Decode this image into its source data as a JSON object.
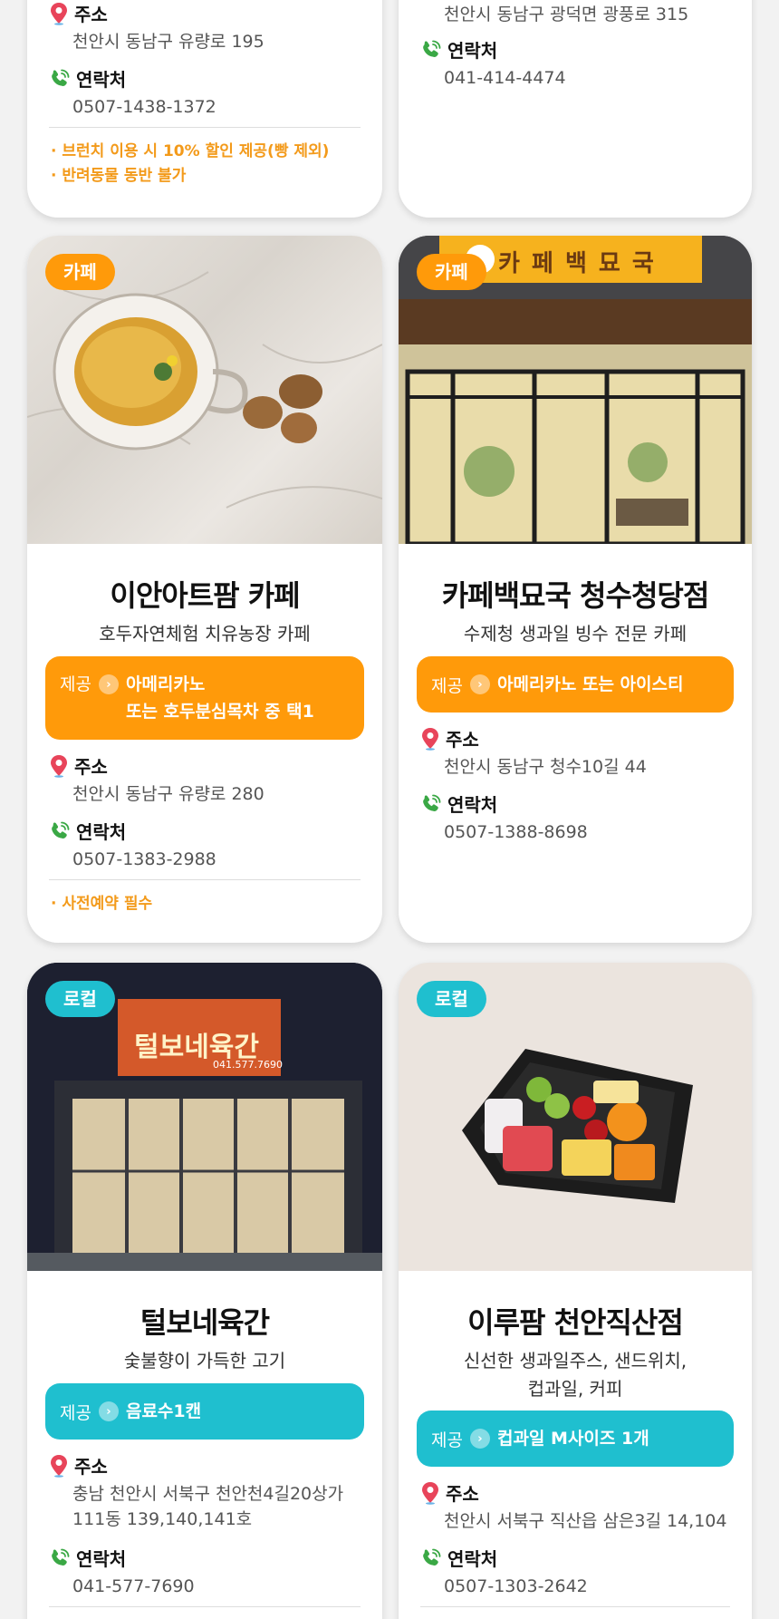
{
  "labels": {
    "address": "주소",
    "contact": "연락처",
    "offer_label": "제공"
  },
  "card_top_left": {
    "address": "천안시 동남구 유량로 195",
    "phone": "0507-1438-1372",
    "notes": [
      "· 브런치 이용 시 10% 할인 제공(빵 제외)",
      "· 반려동물 동반 불가"
    ]
  },
  "card_top_right": {
    "address": "천안시 동남구 광덕면 광풍로 315",
    "phone": "041-414-4474"
  },
  "card_ian": {
    "badge": "카페",
    "title": "이안아트팜 카페",
    "subtitle": "호두자연체험 치유농장 카페",
    "offer_line1": "아메리카노",
    "offer_line2": "또는 호두분심목차 중 택1",
    "address": "천안시 동남구 유량로 280",
    "phone": "0507-1383-2988",
    "note": "· 사전예약  필수"
  },
  "card_baekmyo": {
    "badge": "카페",
    "sign_text": "카 페 백 묘 국",
    "title": "카페백묘국 청수청당점",
    "subtitle": "수제청 생과일 빙수 전문 카페",
    "offer": "아메리카노 또는 아이스티",
    "address": "천안시 동남구 청수10길 44",
    "phone": "0507-1388-8698"
  },
  "card_teolbo": {
    "badge": "로컬",
    "sign_text": "털보네육간",
    "sign_phone": "041.577.7690",
    "title": "털보네육간",
    "subtitle": "숯불향이 가득한 고기",
    "offer": "음료수1캔",
    "address_line1": "충남 천안시 서북구 천안천4길20상가",
    "address_line2": "111동 139,140,141호",
    "phone": "041-577-7690"
  },
  "card_irufarm": {
    "badge": "로컬",
    "title": "이루팜 천안직산점",
    "subtitle_line1": "신선한 생과일주스, 샌드위치,",
    "subtitle_line2": "컵과일, 커피",
    "offer": "컵과일 M사이즈 1개",
    "address": "천안시 서북구 직산읍 삼은3길 14,104",
    "phone": "0507-1303-2642"
  },
  "colors": {
    "orange": "#ff9a0a",
    "teal": "#1fbfcf",
    "note_orange": "#f39a1a",
    "pin_red": "#e8445a",
    "phone_green": "#3aa845"
  }
}
